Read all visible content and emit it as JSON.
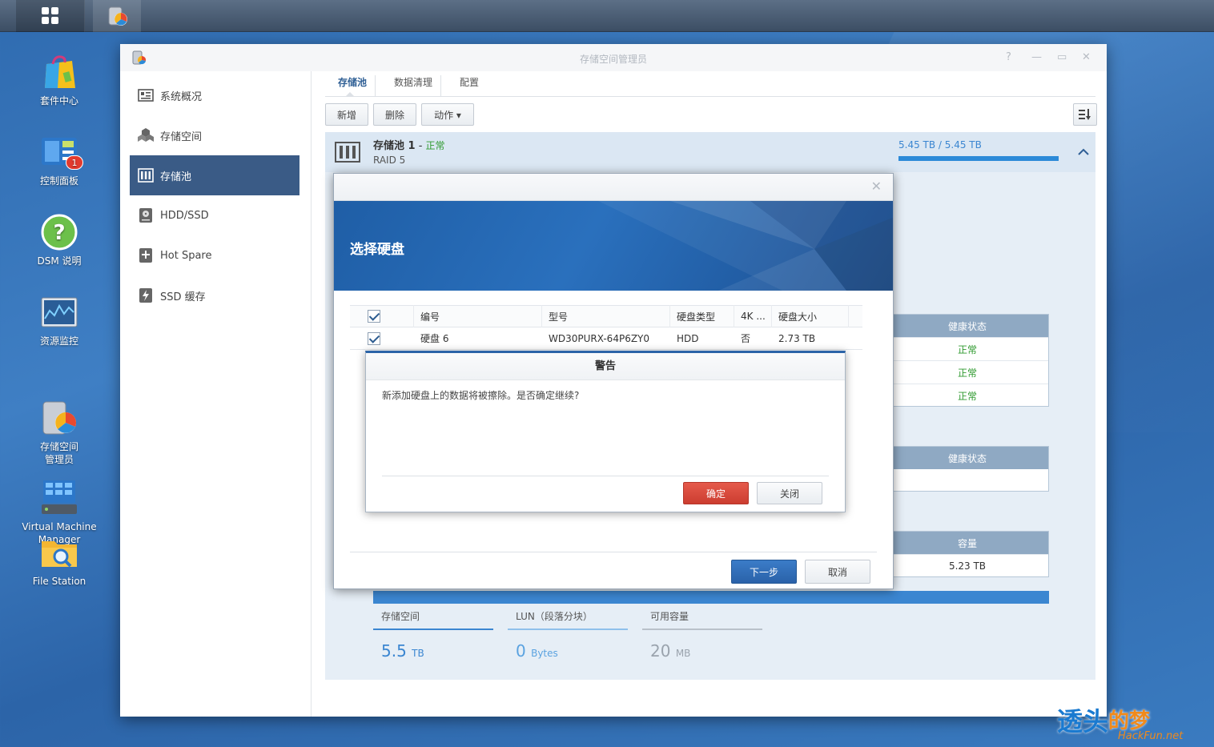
{
  "desktop": {
    "icons": [
      {
        "label": "套件中心"
      },
      {
        "label": "控制面板",
        "badge": "1"
      },
      {
        "label": "DSM 说明"
      },
      {
        "label": "资源监控"
      },
      {
        "label": "存储空间\n管理员"
      },
      {
        "label": "Virtual Machine\nManager"
      },
      {
        "label": "File Station"
      }
    ]
  },
  "window": {
    "title": "存储空间管理员",
    "controls": [
      "?",
      "—",
      "▭",
      "✕"
    ]
  },
  "sidebar": {
    "items": [
      {
        "label": "系统概况"
      },
      {
        "label": "存储空间"
      },
      {
        "label": "存储池",
        "active": true
      },
      {
        "label": "HDD/SSD"
      },
      {
        "label": "Hot Spare"
      },
      {
        "label": "SSD 缓存"
      }
    ]
  },
  "tabs": [
    "存储池",
    "数据清理",
    "配置"
  ],
  "toolbar": {
    "new": "新增",
    "delete": "删除",
    "action": "动作 ▾"
  },
  "pool": {
    "name": "存储池 1",
    "sep": " - ",
    "status": "正常",
    "raid": "RAID 5",
    "usage": "5.45 TB / 5.45 TB",
    "usage_fraction": 1.0
  },
  "bg_tables": {
    "health_header": "健康状态",
    "health_rows": [
      "正常",
      "正常",
      "正常"
    ],
    "health_header2": "健康状态",
    "capacity_header": "容量",
    "capacity_value": "5.23 TB"
  },
  "stats": [
    {
      "label": "存储空间",
      "value": "5.5",
      "unit": "TB"
    },
    {
      "label": "LUN（段落分块）",
      "value": "0",
      "unit": "Bytes"
    },
    {
      "label": "可用容量",
      "value": "20",
      "unit": "MB"
    }
  ],
  "wizard": {
    "title": "选择硬盘",
    "columns": [
      "编号",
      "型号",
      "硬盘类型",
      "4K ...",
      "硬盘大小"
    ],
    "rows": [
      {
        "id": "硬盘 6",
        "model": "WD30PURX-64P6ZY0",
        "type": "HDD",
        "k4": "否",
        "size": "2.73 TB"
      }
    ],
    "next": "下一步",
    "cancel": "取消"
  },
  "warning": {
    "title": "警告",
    "message": "新添加硬盘上的数据将被擦除。是否确定继续?",
    "confirm": "确定",
    "close": "关闭"
  },
  "watermark": {
    "main": "透头",
    "accent": "的梦",
    "site": "HackFun.net"
  },
  "colors": {
    "accent": "#2c64a8",
    "ok": "#2f9a2f",
    "danger": "#cc3d30"
  }
}
